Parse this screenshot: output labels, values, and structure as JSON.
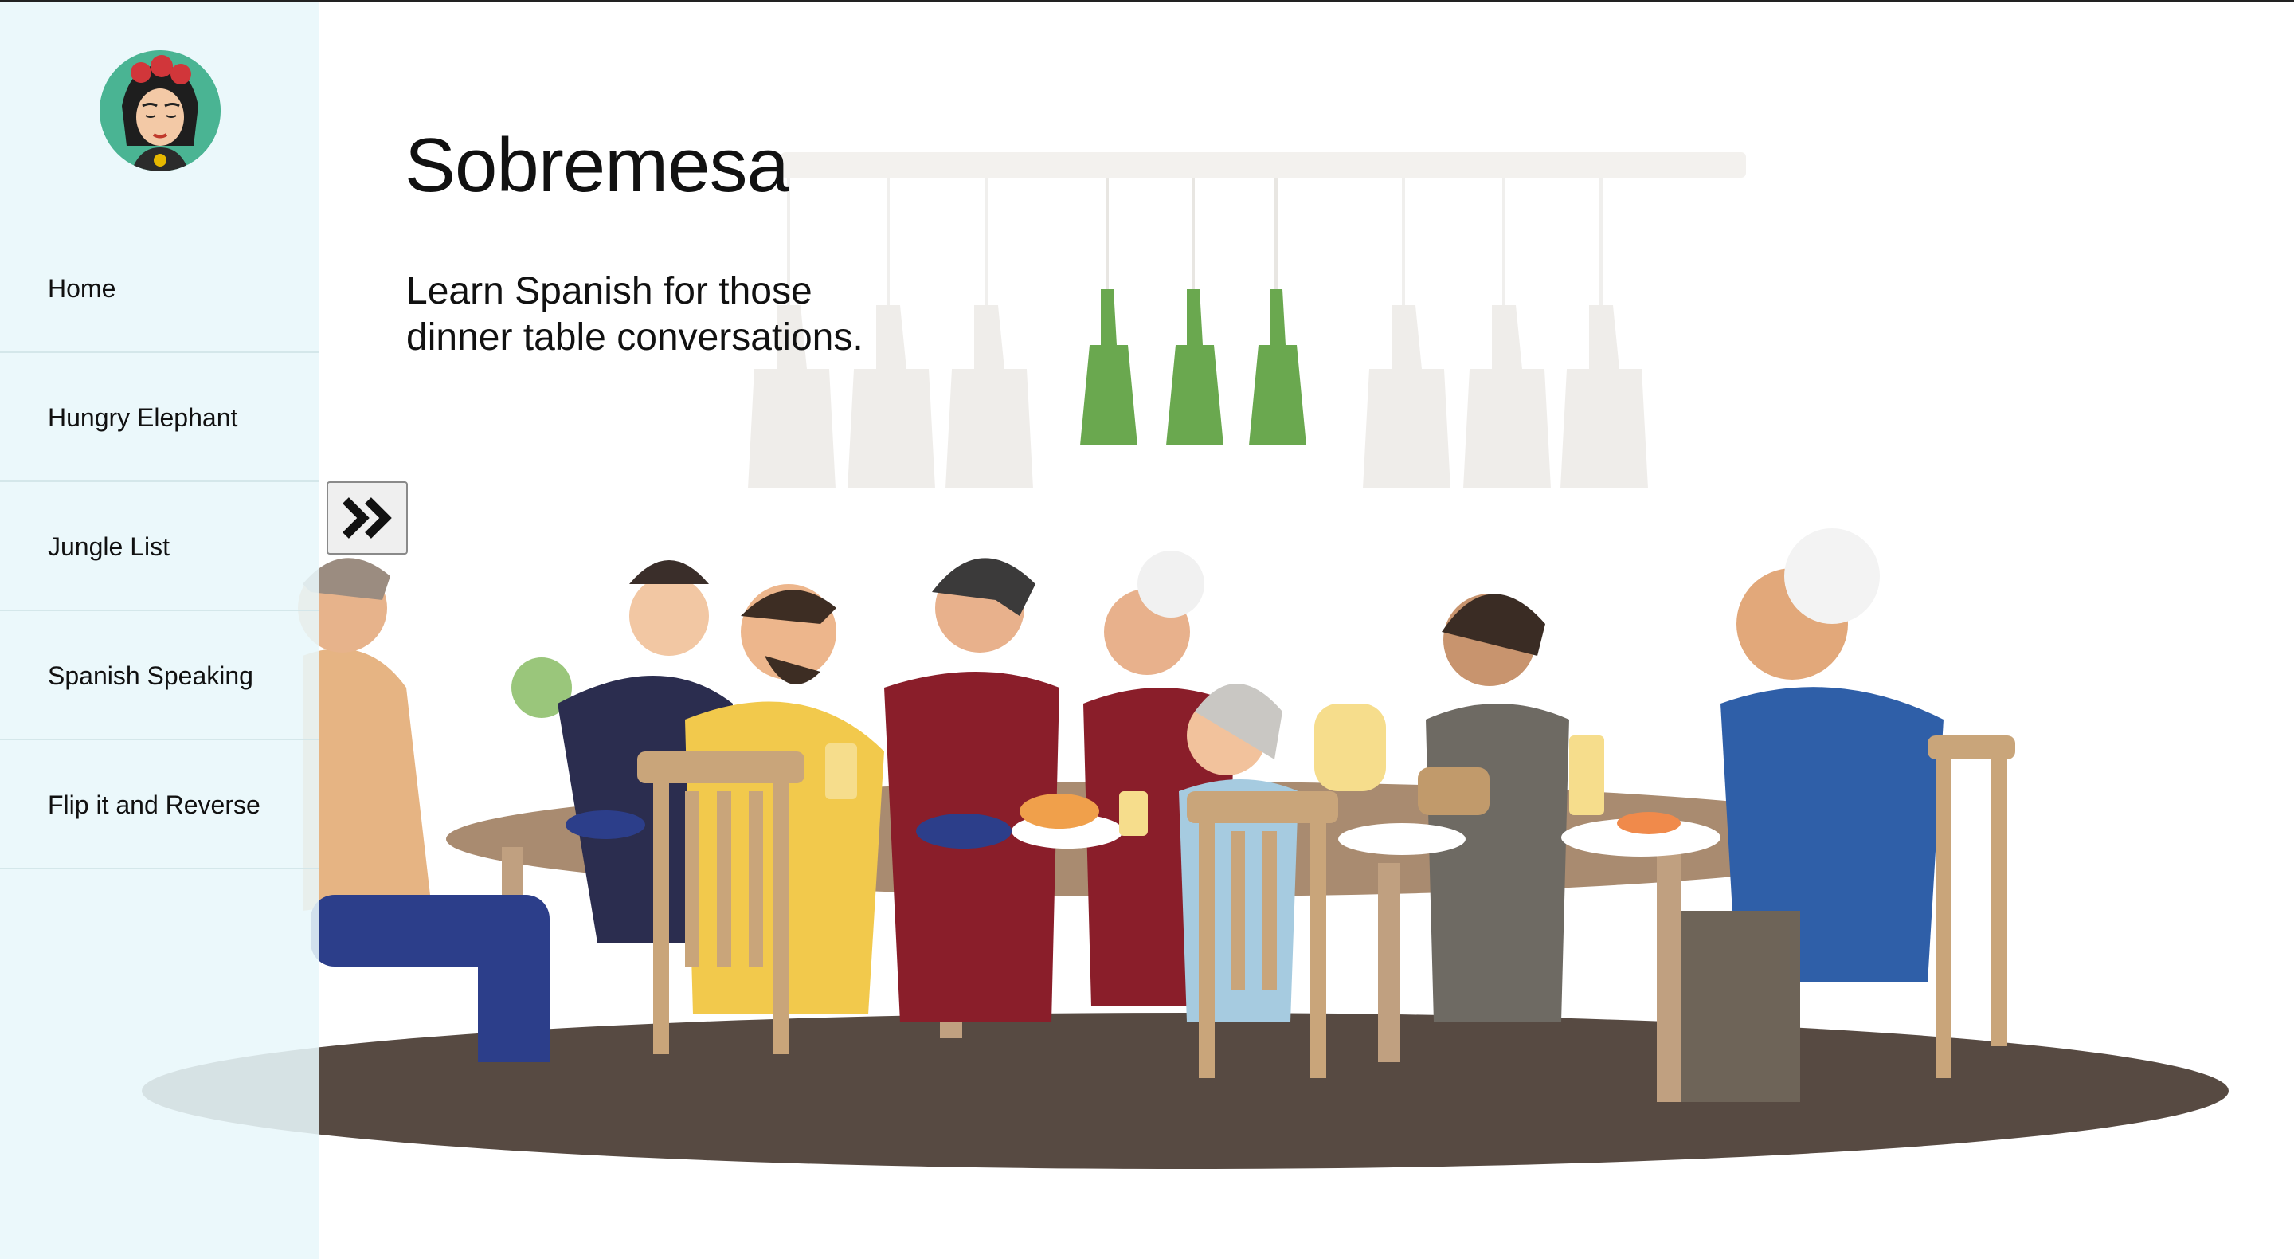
{
  "site": {
    "title": "Sobremesa",
    "tagline": "Learn Spanish for those dinner table conversations."
  },
  "sidebar": {
    "items": [
      {
        "label": "Home"
      },
      {
        "label": "Hungry Elephant"
      },
      {
        "label": "Jungle List"
      },
      {
        "label": "Spanish Speaking"
      },
      {
        "label": "Flip it and Reverse"
      }
    ]
  },
  "toggle": {
    "icon": "double-chevron-right-icon"
  },
  "colors": {
    "sidebar_bg": "#e8f7fa",
    "avatar_bg": "#4ab493",
    "lamp_green": "#6aa84f",
    "floor_shadow": "#574a42"
  }
}
